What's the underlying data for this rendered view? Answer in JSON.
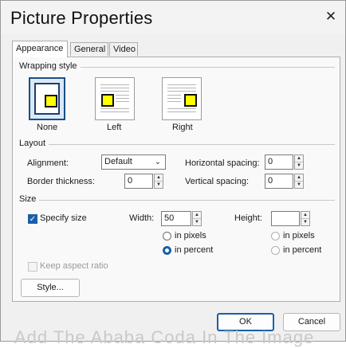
{
  "window": {
    "title": "Picture Properties",
    "close_label": "✕"
  },
  "tabs": [
    {
      "label": "Appearance",
      "active": true
    },
    {
      "label": "General",
      "active": false
    },
    {
      "label": "Video",
      "active": false
    }
  ],
  "wrapping": {
    "section_label": "Wrapping style",
    "options": [
      {
        "label": "None",
        "selected": true
      },
      {
        "label": "Left",
        "selected": false
      },
      {
        "label": "Right",
        "selected": false
      }
    ]
  },
  "layout": {
    "section_label": "Layout",
    "alignment_label": "Alignment:",
    "alignment_value": "Default",
    "border_label": "Border thickness:",
    "border_value": "0",
    "hspace_label": "Horizontal spacing:",
    "hspace_value": "0",
    "vspace_label": "Vertical spacing:",
    "vspace_value": "0"
  },
  "size": {
    "section_label": "Size",
    "specify_label": "Specify size",
    "specify_checked": true,
    "width_label": "Width:",
    "width_value": "50",
    "height_label": "Height:",
    "height_value": "",
    "width_unit_pixels": "in pixels",
    "width_unit_percent": "in percent",
    "width_unit_selected": "percent",
    "height_unit_pixels": "in pixels",
    "height_unit_percent": "in percent",
    "keep_aspect_label": "Keep aspect ratio",
    "keep_aspect_enabled": false
  },
  "buttons": {
    "style": "Style...",
    "ok": "OK",
    "cancel": "Cancel"
  },
  "background_text": "Add The Ababa Coda In The Image",
  "colors": {
    "accent": "#1b5fa8",
    "selected_border": "#1b4f87",
    "sample_yellow": "#ffff00"
  }
}
